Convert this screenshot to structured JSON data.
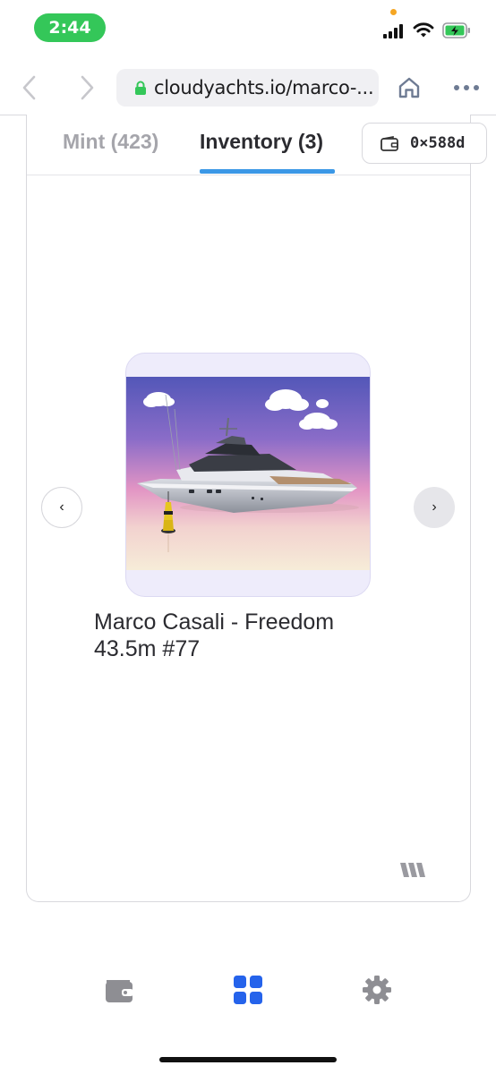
{
  "status_bar": {
    "time": "2:44",
    "icons": [
      "signal-icon",
      "wifi-icon",
      "battery-charging-icon"
    ]
  },
  "browser": {
    "url": "cloudyachts.io/marco-...",
    "icons": [
      "back-arrow-icon",
      "forward-arrow-icon",
      "lock-icon",
      "home-icon",
      "more-icon"
    ],
    "colors": {
      "lock": "#34c759",
      "nav_disabled": "#c7c7cc",
      "action": "#6e7b93"
    }
  },
  "widget": {
    "tabs": [
      {
        "label": "Mint (423)",
        "active": false
      },
      {
        "label": "Inventory (3)",
        "active": true
      }
    ],
    "wallet_address": "0×588d",
    "accent_color": "#3b98e6",
    "carousel": {
      "prev_icon": "chevron-left-icon",
      "next_icon": "chevron-right-icon",
      "prev_glyph": "‹",
      "next_glyph": "›",
      "item": {
        "title_line1": "Marco Casali - Freedom",
        "title_line2": "43.5m #77"
      }
    },
    "brand_icon": "brand-logo-icon"
  },
  "bottom_nav": {
    "items": [
      {
        "name": "wallet",
        "icon": "wallet-icon",
        "active": false
      },
      {
        "name": "gallery",
        "icon": "grid-icon",
        "active": true
      },
      {
        "name": "settings",
        "icon": "gear-icon",
        "active": false
      }
    ],
    "active_color": "#2563eb",
    "inactive_color": "#8e8e93"
  }
}
